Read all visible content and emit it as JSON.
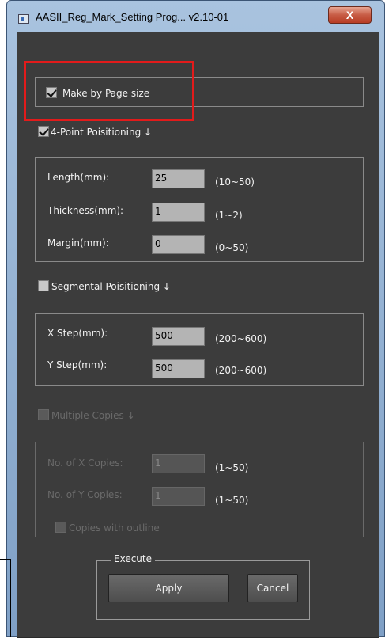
{
  "window": {
    "title": "AASII_Reg_Mark_Setting Prog... v2.10-01",
    "close_label": "X"
  },
  "page_size": {
    "label": "Make by Page size",
    "checked": true
  },
  "four_point": {
    "label": "4-Point Poisitioning ↓",
    "checked": true,
    "fields": [
      {
        "label": "Length(mm):",
        "value": "25",
        "range": "(10~50)"
      },
      {
        "label": "Thickness(mm):",
        "value": "1",
        "range": "(1~2)"
      },
      {
        "label": "Margin(mm):",
        "value": "0",
        "range": "(0~50)"
      }
    ]
  },
  "segmental": {
    "label": "Segmental Poisitioning ↓",
    "checked": false,
    "fields": [
      {
        "label": "X Step(mm):",
        "value": "500",
        "range": "(200~600)"
      },
      {
        "label": "Y Step(mm):",
        "value": "500",
        "range": "(200~600)"
      }
    ]
  },
  "multiple": {
    "label": "Multiple Copies ↓",
    "checked": false,
    "fields": [
      {
        "label": "No. of X Copies:",
        "value": "1",
        "range": "(1~50)"
      },
      {
        "label": "No. of Y Copies:",
        "value": "1",
        "range": "(1~50)"
      }
    ],
    "outline_label": "Copies with outline"
  },
  "execute": {
    "group_label": "Execute",
    "apply_label": "Apply",
    "cancel_label": "Cancel"
  }
}
